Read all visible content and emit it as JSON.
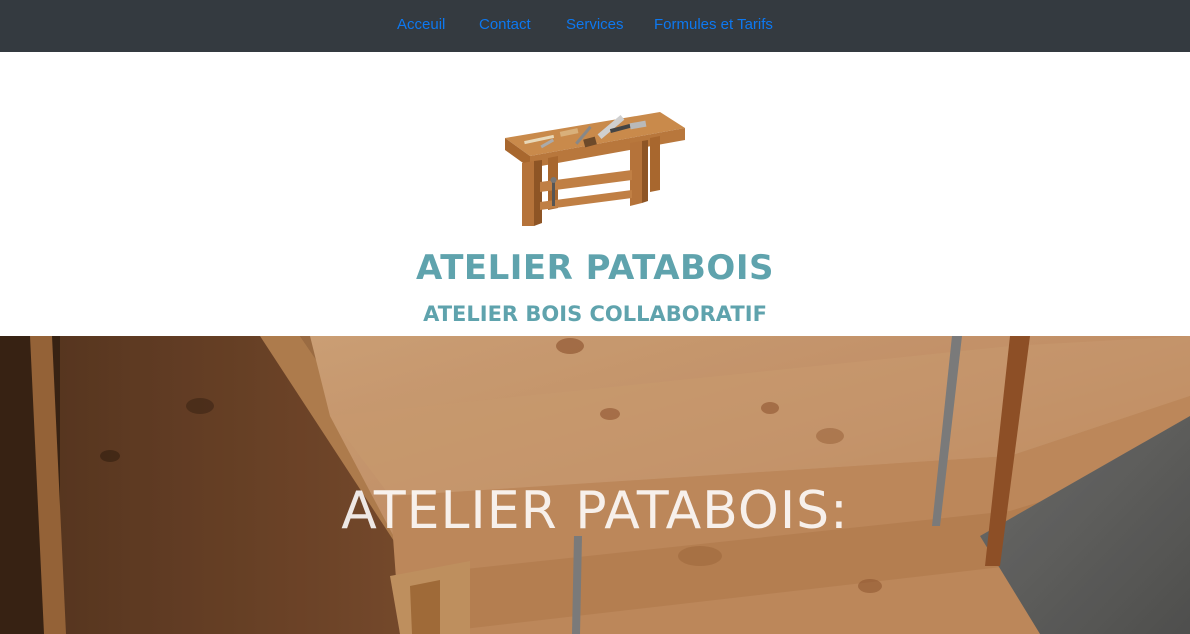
{
  "nav": {
    "items": [
      {
        "label": "Acceuil"
      },
      {
        "label": "Contact"
      },
      {
        "label": "Services"
      },
      {
        "label": "Formules et Tarifs"
      }
    ],
    "link_color": "#0d78f0",
    "background": "#343a40"
  },
  "header": {
    "logo_icon": "workbench-icon",
    "title": "ATELIER PATABOIS",
    "subtitle": "ATELIER BOIS COLLABORATIF",
    "accent_color": "#5fa3ad"
  },
  "hero": {
    "title": "ATELIER PATABOIS:",
    "background": "wood-planks-photo"
  }
}
